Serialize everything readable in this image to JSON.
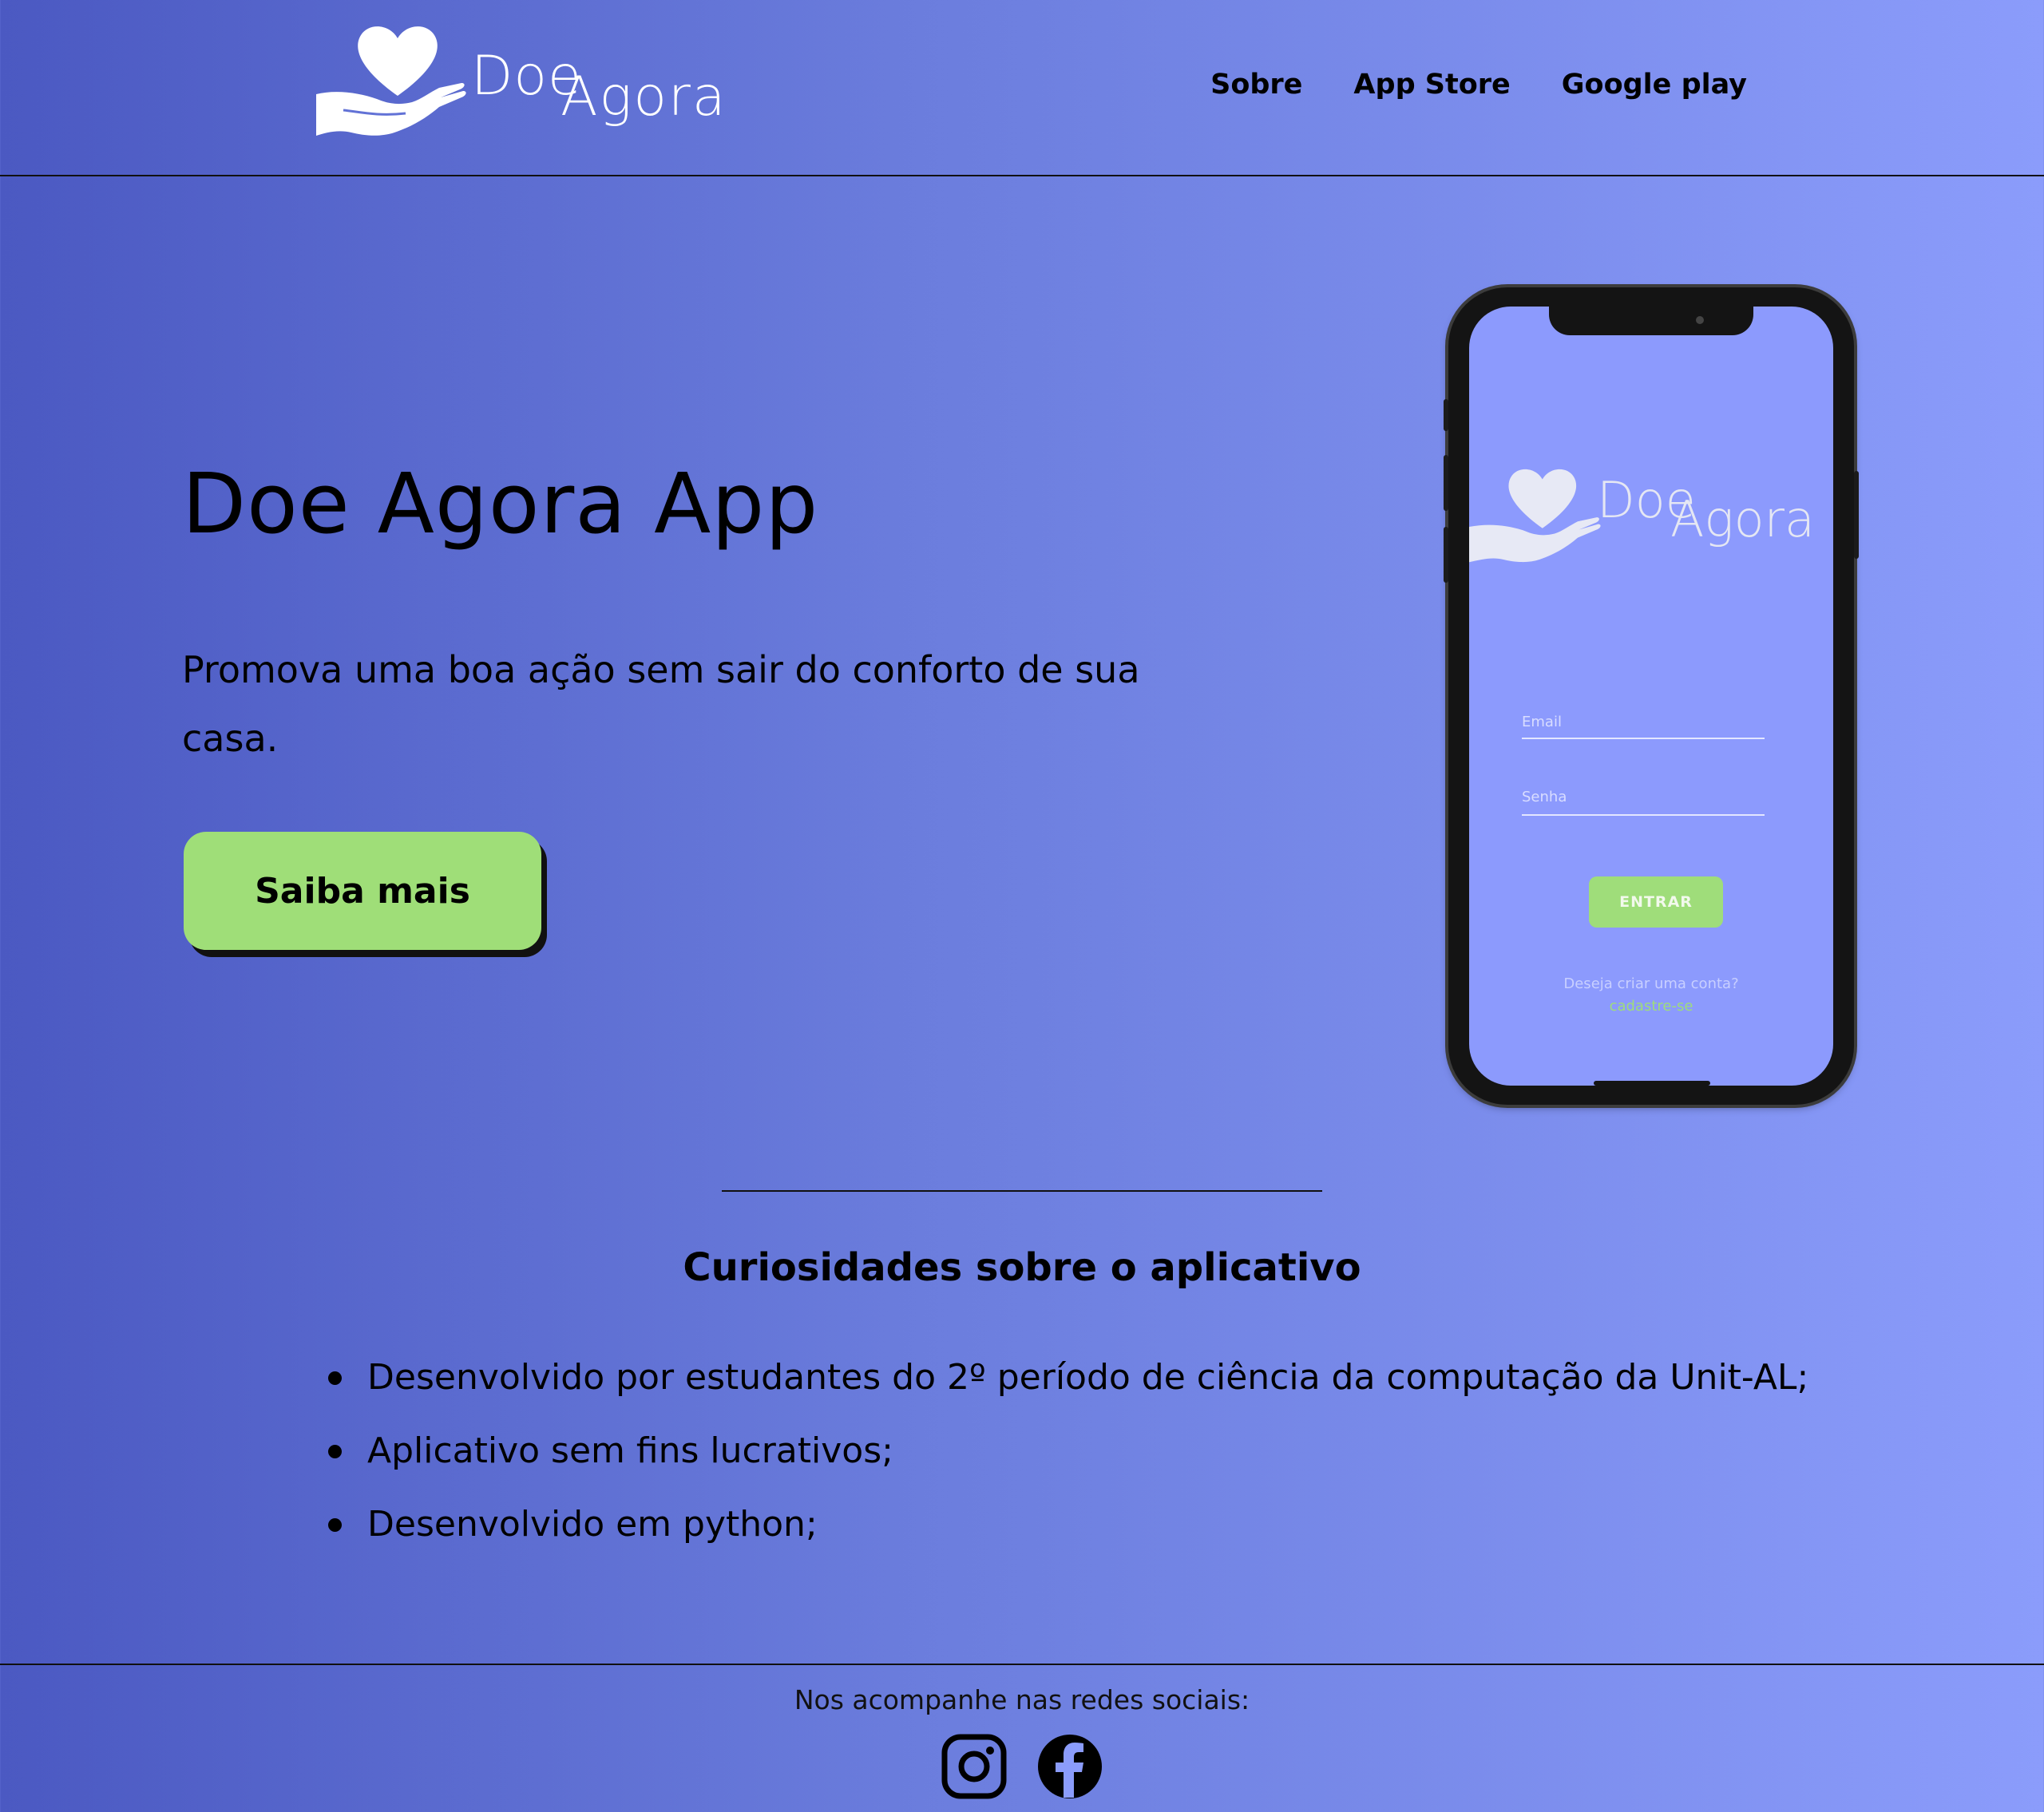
{
  "header": {
    "logo": {
      "word1": "Doe",
      "word2": "Agora"
    },
    "nav": [
      {
        "label": "Sobre"
      },
      {
        "label": "App Store"
      },
      {
        "label": "Google play"
      }
    ]
  },
  "hero": {
    "title": "Doe Agora App",
    "text": "Promova uma boa ação sem sair do conforto de sua casa.",
    "cta_label": "Saiba mais"
  },
  "phone": {
    "email_label": "Email",
    "password_label": "Senha",
    "enter_label": "ENTRAR",
    "create_question": "Deseja criar uma conta?",
    "create_link": "cadastre-se"
  },
  "curiosities": {
    "title": "Curiosidades sobre o aplicativo",
    "items": [
      "Desenvolvido por estudantes do 2º período de ciência da computação da Unit-AL;",
      "Aplicativo sem fins lucrativos;",
      "Desenvolvido em python;"
    ]
  },
  "footer": {
    "text": "Nos acompanhe nas redes sociais:",
    "social": [
      {
        "icon": "instagram-icon"
      },
      {
        "icon": "facebook-icon"
      }
    ]
  },
  "colors": {
    "gradient_left": "#4b59c2",
    "gradient_right": "#8b9cfb",
    "accent_green": "#9fde78",
    "phone_screen": "#8c9afd"
  }
}
